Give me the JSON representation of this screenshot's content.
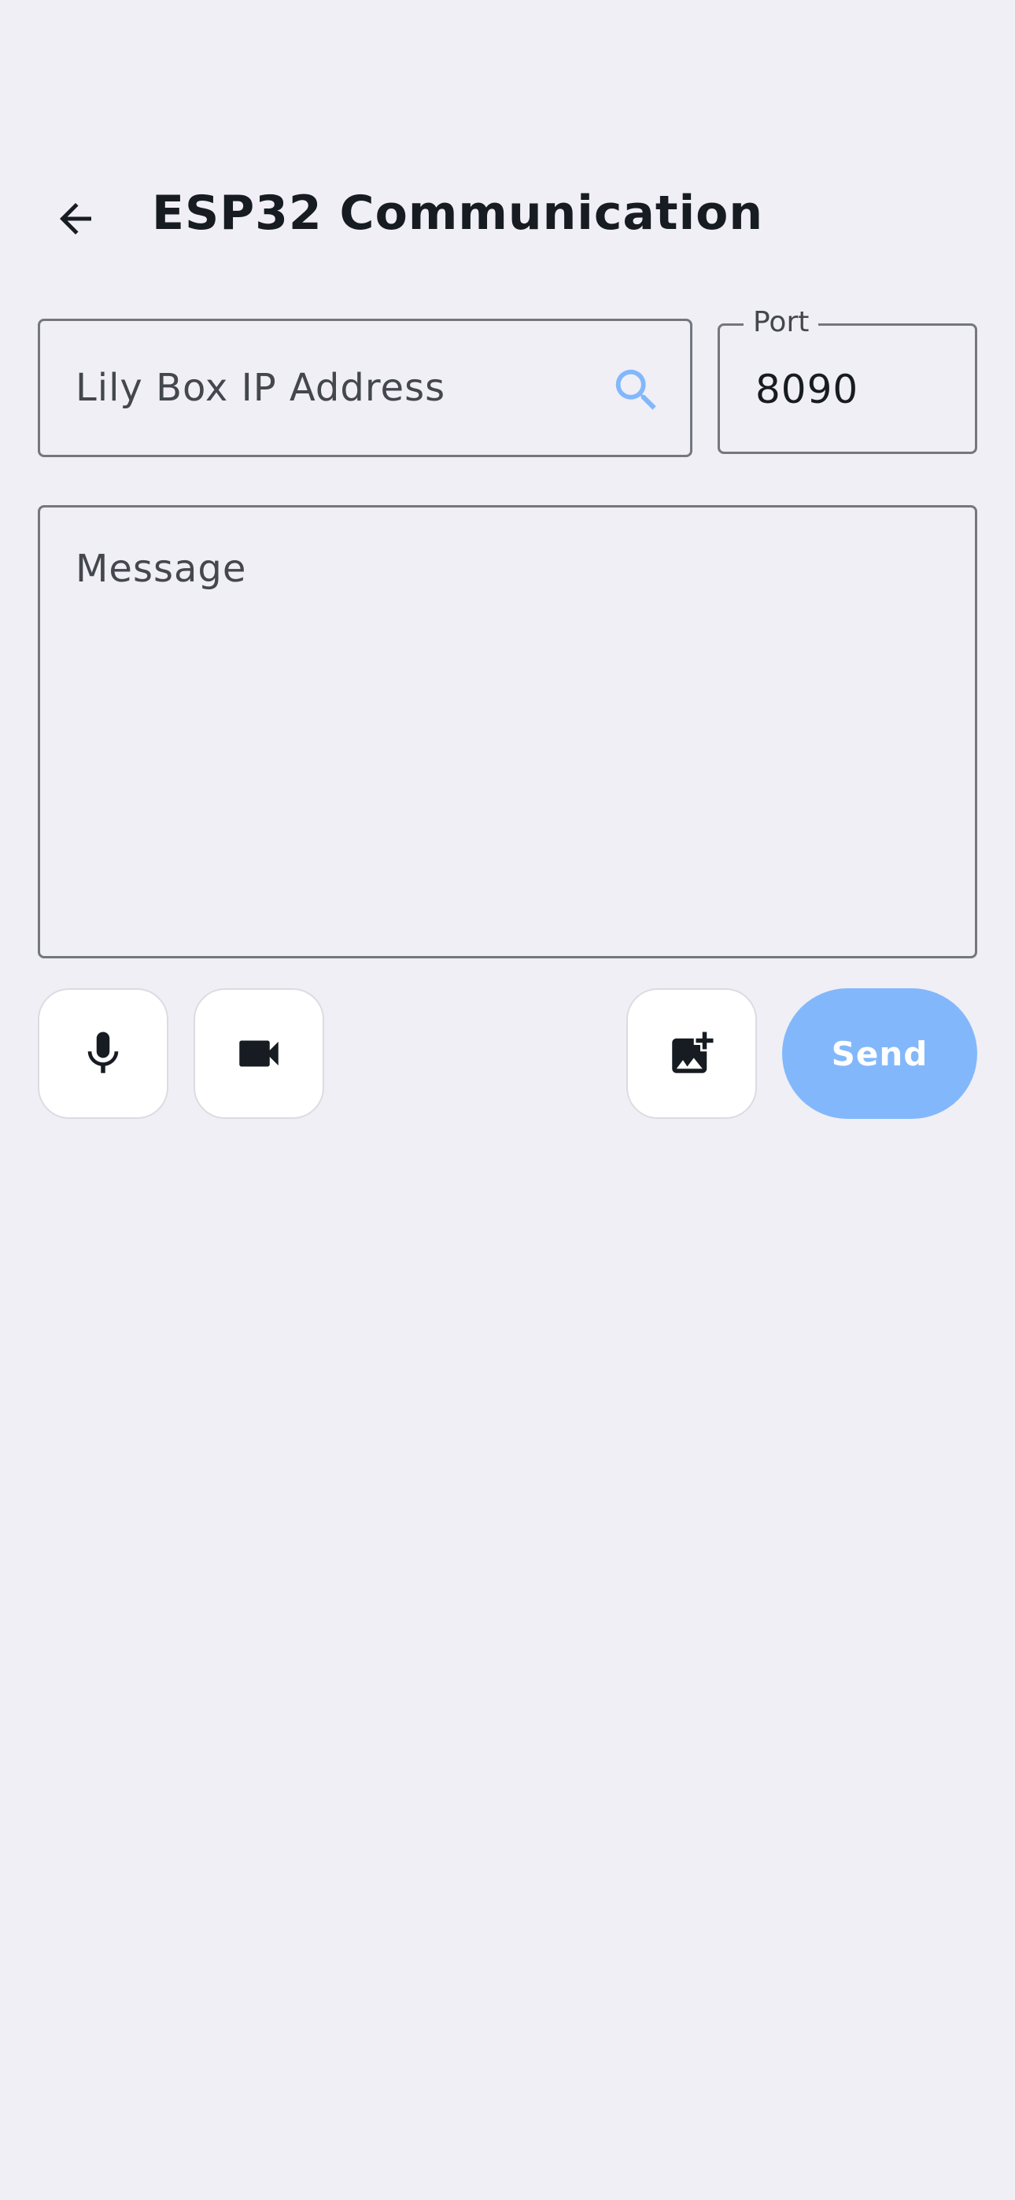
{
  "app_bar": {
    "title": "ESP32 Communication",
    "back_icon": "arrow-back-icon"
  },
  "ip_field": {
    "placeholder": "Lily Box IP Address",
    "value": "",
    "search_icon": "search-icon"
  },
  "port_field": {
    "label": "Port",
    "value": "8090"
  },
  "message_field": {
    "placeholder": "Message",
    "value": ""
  },
  "actions": {
    "mic_icon": "mic-icon",
    "video_icon": "videocam-icon",
    "image_icon": "add-photo-icon",
    "send_label": "Send"
  },
  "colors": {
    "background": "#f0eff5",
    "accent": "#82b8fb",
    "text_primary": "#171c22",
    "outline": "#74777f"
  }
}
